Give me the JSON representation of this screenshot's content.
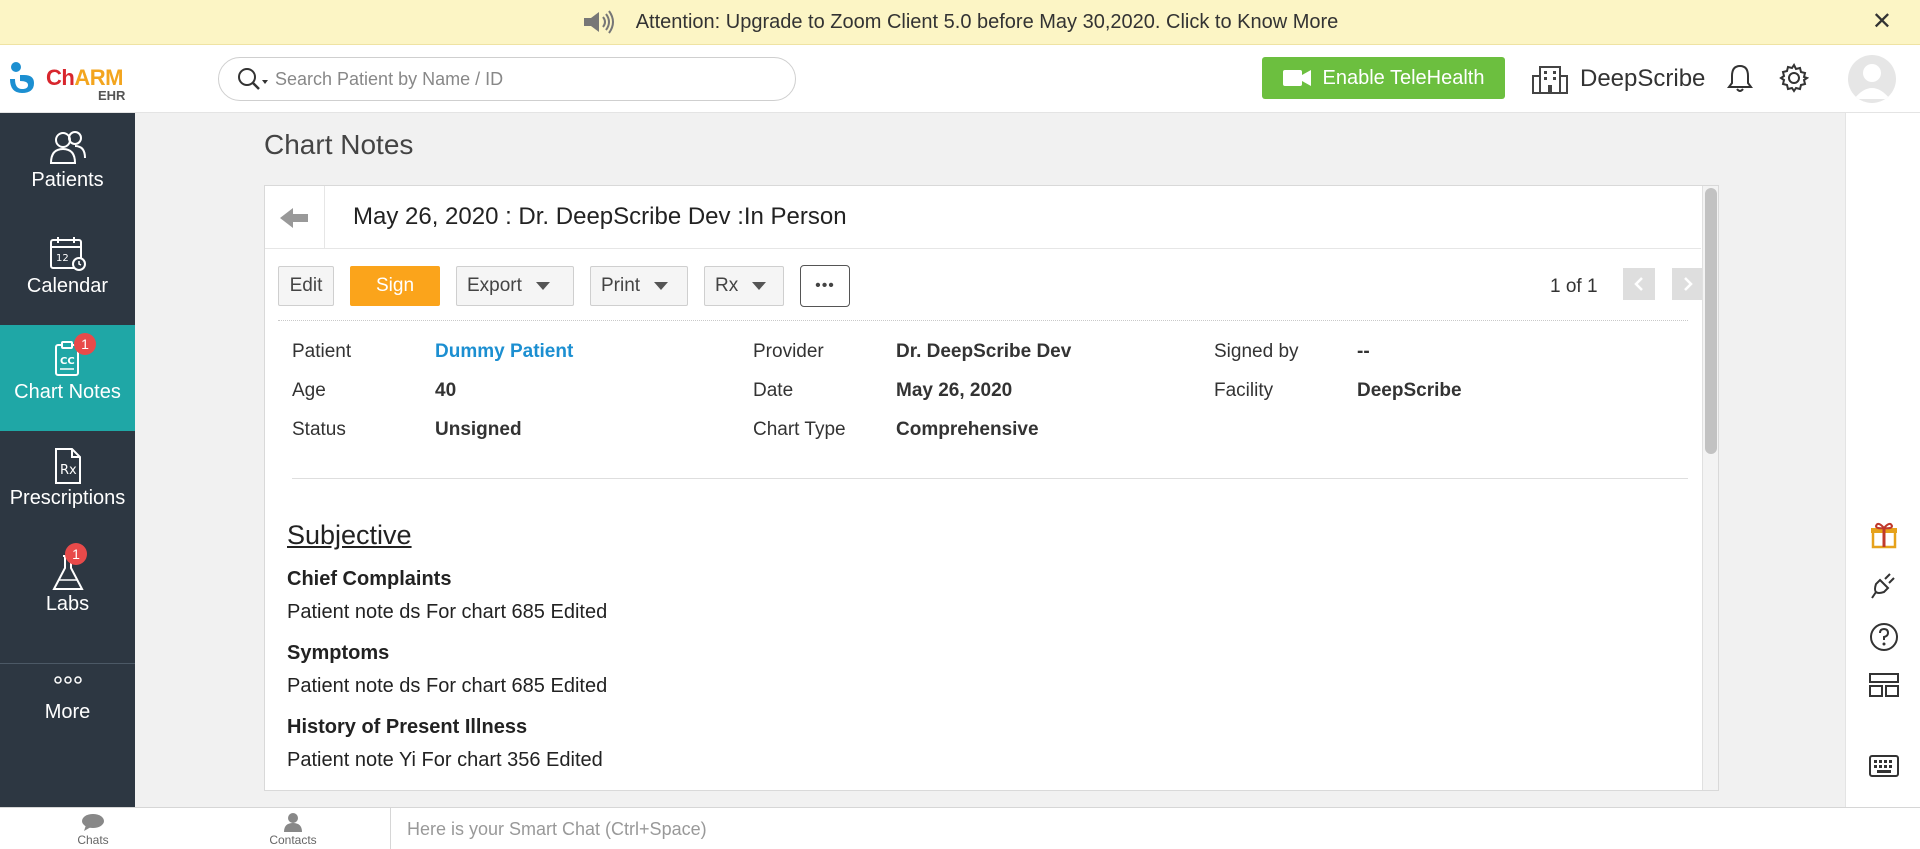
{
  "banner": {
    "text": "Attention: Upgrade to Zoom Client 5.0 before May 30,2020. Click to Know More",
    "close": "✕"
  },
  "header": {
    "logo_brand_a": "Ch",
    "logo_brand_b": "ARM",
    "logo_sub": "EHR",
    "search_placeholder": "Search Patient by Name / ID",
    "telehealth_label": "Enable TeleHealth",
    "org_name": "DeepScribe"
  },
  "sidebar": {
    "items": [
      {
        "label": "Patients",
        "icon": "patients-icon"
      },
      {
        "label": "Calendar",
        "icon": "calendar-icon"
      },
      {
        "label": "Chart Notes",
        "icon": "chart-notes-icon",
        "badge": "1",
        "active": true
      },
      {
        "label": "Prescriptions",
        "icon": "prescription-icon"
      },
      {
        "label": "Labs",
        "icon": "labs-icon",
        "badge": "1"
      },
      {
        "label": "More",
        "icon": "more-icon"
      }
    ]
  },
  "main": {
    "page_title": "Chart Notes",
    "card_title": "May 26, 2020 : Dr. DeepScribe Dev :In Person",
    "toolbar": {
      "edit": "Edit",
      "sign": "Sign",
      "export": "Export",
      "print": "Print",
      "rx": "Rx",
      "more": "•••"
    },
    "pager": "1 of 1",
    "info": {
      "patient_label": "Patient",
      "patient_value": "Dummy Patient",
      "age_label": "Age",
      "age_value": "40",
      "status_label": "Status",
      "status_value": "Unsigned",
      "provider_label": "Provider",
      "provider_value": "Dr. DeepScribe Dev",
      "date_label": "Date",
      "date_value": "May 26, 2020",
      "chart_type_label": "Chart Type",
      "chart_type_value": "Comprehensive",
      "signed_by_label": "Signed by",
      "signed_by_value": "--",
      "facility_label": "Facility",
      "facility_value": "DeepScribe"
    },
    "subjective": {
      "title": "Subjective",
      "sections": [
        {
          "heading": "Chief Complaints",
          "text": "Patient note ds For chart 685 Edited"
        },
        {
          "heading": "Symptoms",
          "text": "Patient note ds For chart 685 Edited"
        },
        {
          "heading": "History of Present Illness",
          "text": "Patient note Yi For chart 356 Edited"
        }
      ]
    }
  },
  "bottombar": {
    "chats": "Chats",
    "contacts": "Contacts",
    "smart_chat_placeholder": "Here is your Smart Chat (Ctrl+Space)"
  },
  "colors": {
    "sidebar_bg": "#2d3742",
    "active_nav": "#1fa7a6",
    "telehealth_green": "#6cbf3f",
    "sign_orange": "#fba41b",
    "link_blue": "#1c8fd1",
    "banner_bg": "#fcf5c5"
  }
}
